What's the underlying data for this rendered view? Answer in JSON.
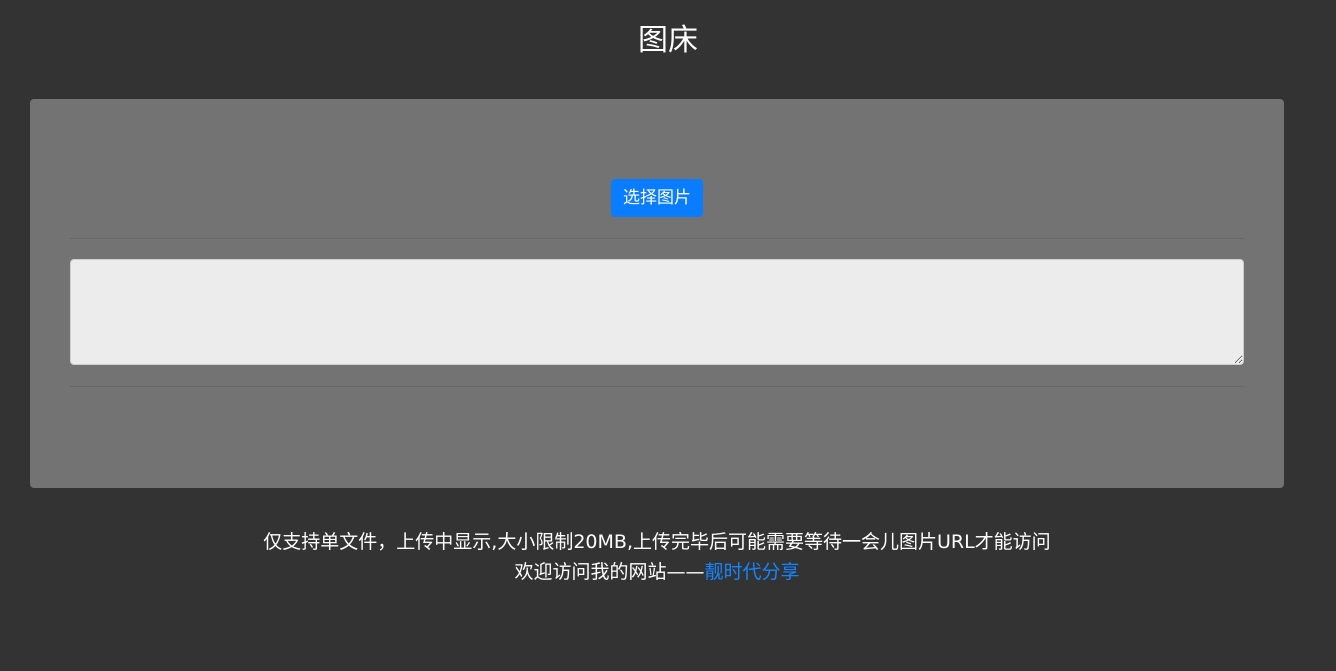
{
  "header": {
    "title": "图床"
  },
  "upload": {
    "select_button_label": "选择图片",
    "url_output_value": "",
    "url_output_placeholder": ""
  },
  "footer": {
    "notice": "仅支持单文件，上传中显示,大小限制20MB,上传完毕后可能需要等待一会儿图片URL才能访问",
    "welcome_prefix": "欢迎访问我的网站——",
    "site_link_label": "靓时代分享"
  },
  "colors": {
    "background": "#333333",
    "panel": "#737373",
    "accent": "#0a7cff",
    "link": "#1585ff"
  }
}
